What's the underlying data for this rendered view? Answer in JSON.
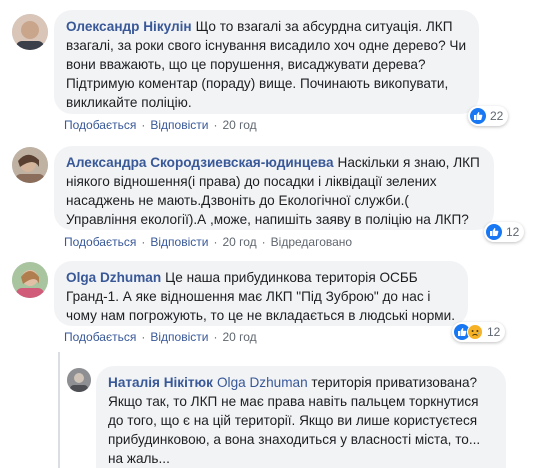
{
  "comments": [
    {
      "author": "Олександр Нікулін",
      "text": "Що то взагалі за абсурдна ситуація. ЛКП взагалі, за роки свого існування висадило хоч одне дерево? Чи вони вважають, що це порушення, висаджувати дерева? Підтримую коментар (пораду) вище. Починають викопувати, викликайте поліцію.",
      "like_label": "Подобається",
      "reply_label": "Відповісти",
      "time": "20 год",
      "reaction_count": "22"
    },
    {
      "author": "Александра Скородзиевская-юдинцева",
      "text": "Наскільки я знаю, ЛКП ніякого відношення(і права) до посадки і ліквідації зелених насаджень не мають.Дзвоніть до Екологічної служби.( Управління екології).А ,може, напишіть заяву в поліцію на ЛКП?",
      "like_label": "Подобається",
      "reply_label": "Відповісти",
      "time": "20 год",
      "edited": "Відредаговано",
      "reaction_count": "12"
    },
    {
      "author": "Olga Dzhuman",
      "text": "Це наша прибудинкова територія ОСББ Гранд-1. А яке відношення має ЛКП \"Під Зуброю\" до нас і чому нам погрожують, то це не вкладається в людські норми.",
      "like_label": "Подобається",
      "reply_label": "Відповісти",
      "time": "20 год",
      "reaction_count": "12"
    },
    {
      "author": "Наталія Нікітюк",
      "mention": "Olga Dzhuman",
      "text": "територія приватизована? Якщо так, то ЛКП не має права навіть пальцем торкнутися до того, що є на цій території. Якщо ви лише користуєтеся прибудинковою, а вона знаходиться у власності міста, то...",
      "more_label": "на жаль..."
    }
  ],
  "colors": {
    "author": "#385898",
    "bubble": "#f2f3f5",
    "meta": "#606770",
    "like": "#1877f2",
    "sad": "#f7b125"
  }
}
